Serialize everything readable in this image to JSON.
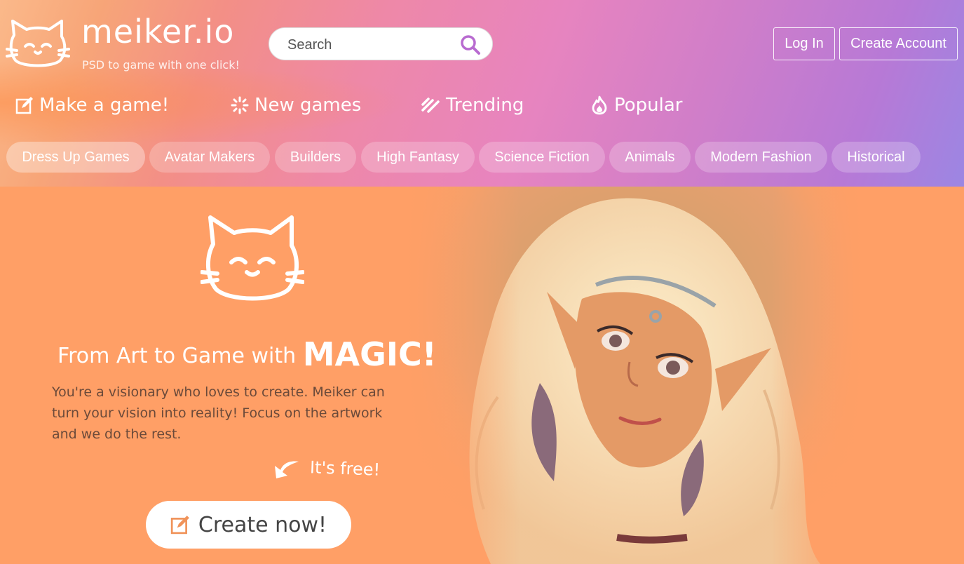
{
  "brand": {
    "name": "meiker.io",
    "tagline": "PSD to game with one click!"
  },
  "search": {
    "placeholder": "Search"
  },
  "auth": {
    "login": "Log In",
    "signup": "Create Account"
  },
  "nav": [
    {
      "label": "Make a game!",
      "icon": "edit-icon"
    },
    {
      "label": "New games",
      "icon": "sparkle-icon"
    },
    {
      "label": "Trending",
      "icon": "trending-icon"
    },
    {
      "label": "Popular",
      "icon": "flame-icon"
    }
  ],
  "categories": [
    "Dress Up Games",
    "Avatar Makers",
    "Builders",
    "High Fantasy",
    "Science Fiction",
    "Animals",
    "Modern Fashion",
    "Historical"
  ],
  "hero": {
    "title_prefix": "From Art to Game with",
    "title_emphasis": "MAGIC!",
    "body": "You're a visionary who loves to create. Meiker can turn your vision into reality! Focus on the artwork and we do the rest.",
    "free_note": "It's free!",
    "cta": "Create now!"
  },
  "colors": {
    "hero_bg": "#ff9f66",
    "accent_purple": "#b86bd0",
    "cta_icon": "#f0935a"
  }
}
